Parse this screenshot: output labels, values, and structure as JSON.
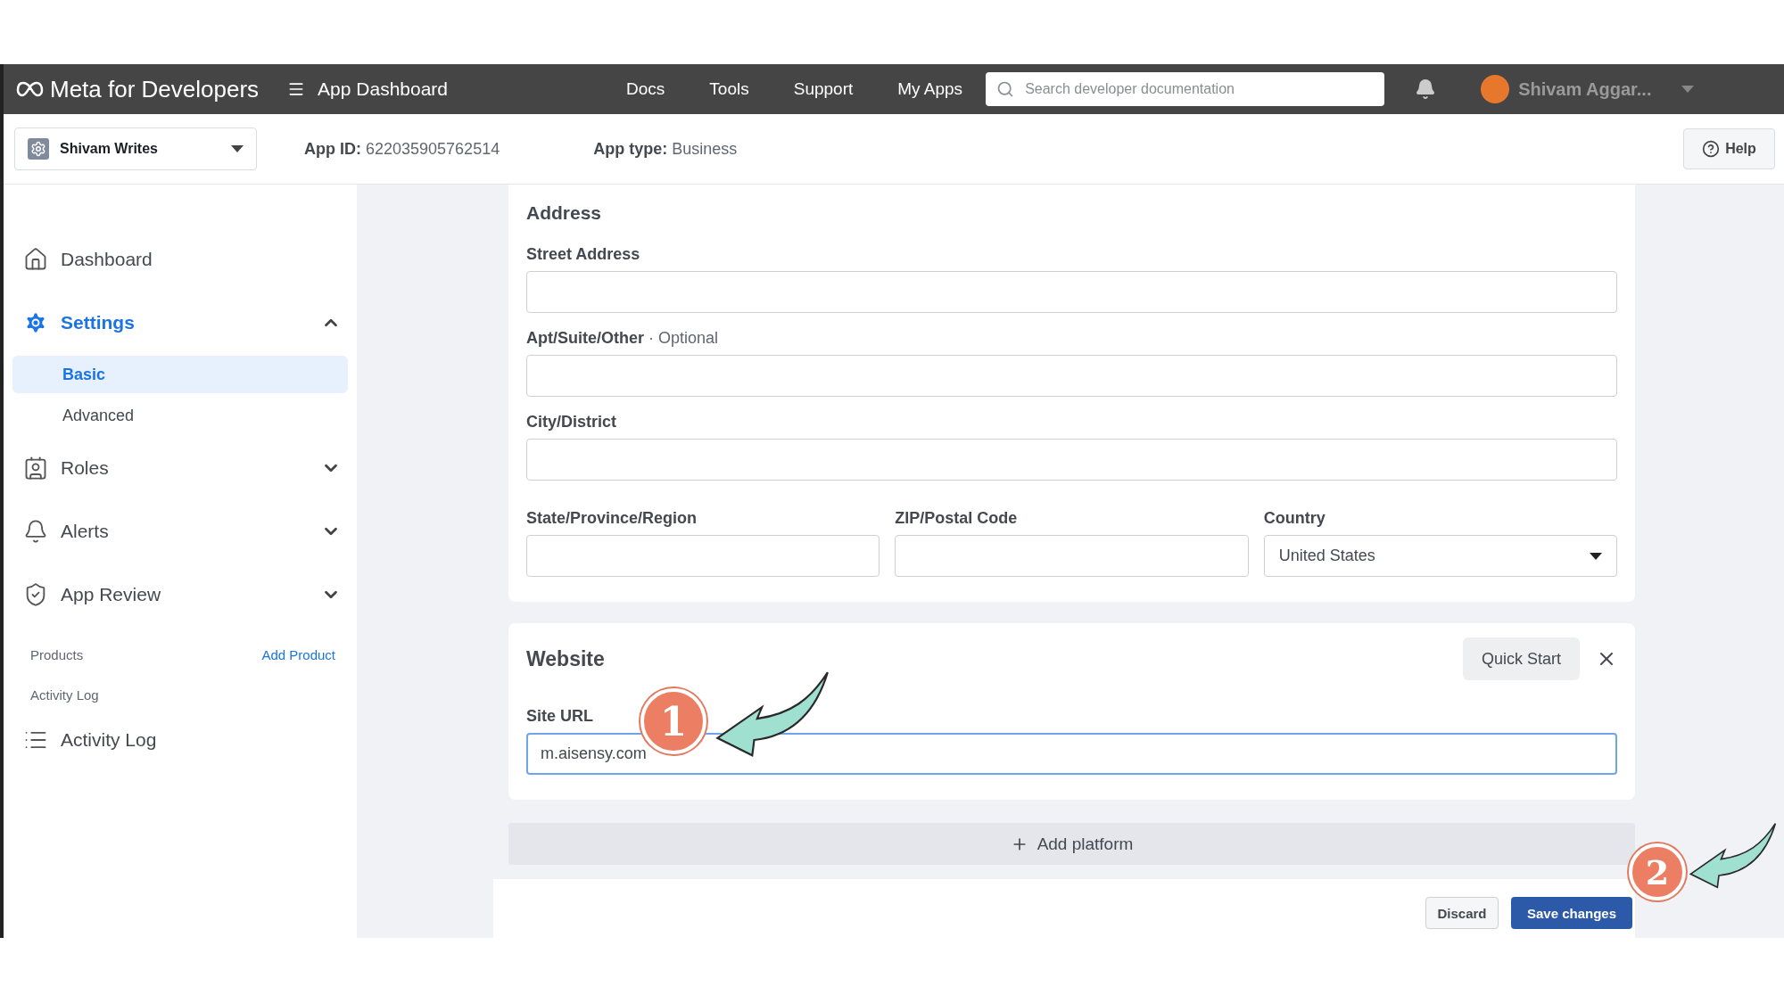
{
  "header": {
    "logo": "Meta for Developers",
    "app_dashboard": "App Dashboard",
    "nav": [
      "Docs",
      "Tools",
      "Support",
      "My Apps"
    ],
    "search": {
      "placeholder": "Search developer documentation"
    },
    "user": "Shivam Aggar..."
  },
  "subbar": {
    "app_name": "Shivam Writes",
    "app_id_label": "App ID:",
    "app_id": "622035905762514",
    "app_type_label": "App type:",
    "app_type": "Business",
    "help": "Help"
  },
  "sidebar": {
    "items": [
      {
        "label": "Dashboard",
        "kind": "home",
        "selected": false
      },
      {
        "label": "Settings",
        "kind": "gear",
        "selected": true,
        "expanded": true,
        "children": [
          {
            "label": "Basic",
            "selected": true
          },
          {
            "label": "Advanced",
            "selected": false
          }
        ]
      },
      {
        "label": "Roles",
        "kind": "badge",
        "selected": false,
        "expanded": false
      },
      {
        "label": "Alerts",
        "kind": "bell",
        "selected": false,
        "expanded": false
      },
      {
        "label": "App Review",
        "kind": "shield",
        "selected": false,
        "expanded": false
      }
    ],
    "products_label": "Products",
    "add_product": "Add Product",
    "activity_header": "Activity Log",
    "activity_item": "Activity Log"
  },
  "address": {
    "title": "Address",
    "street": {
      "label": "Street Address"
    },
    "apt": {
      "label": "Apt/Suite/Other",
      "note": "· Optional"
    },
    "city": {
      "label": "City/District"
    },
    "state": {
      "label": "State/Province/Region"
    },
    "zip": {
      "label": "ZIP/Postal Code"
    },
    "country": {
      "label": "Country",
      "value": "United States"
    }
  },
  "website": {
    "title": "Website",
    "quick_start": "Quick Start",
    "site_url": {
      "label": "Site URL",
      "value": "m.aisensy.com"
    }
  },
  "add_platform": "Add platform",
  "footer": {
    "discard": "Discard",
    "save": "Save changes"
  },
  "annotations": [
    "1",
    "2"
  ]
}
